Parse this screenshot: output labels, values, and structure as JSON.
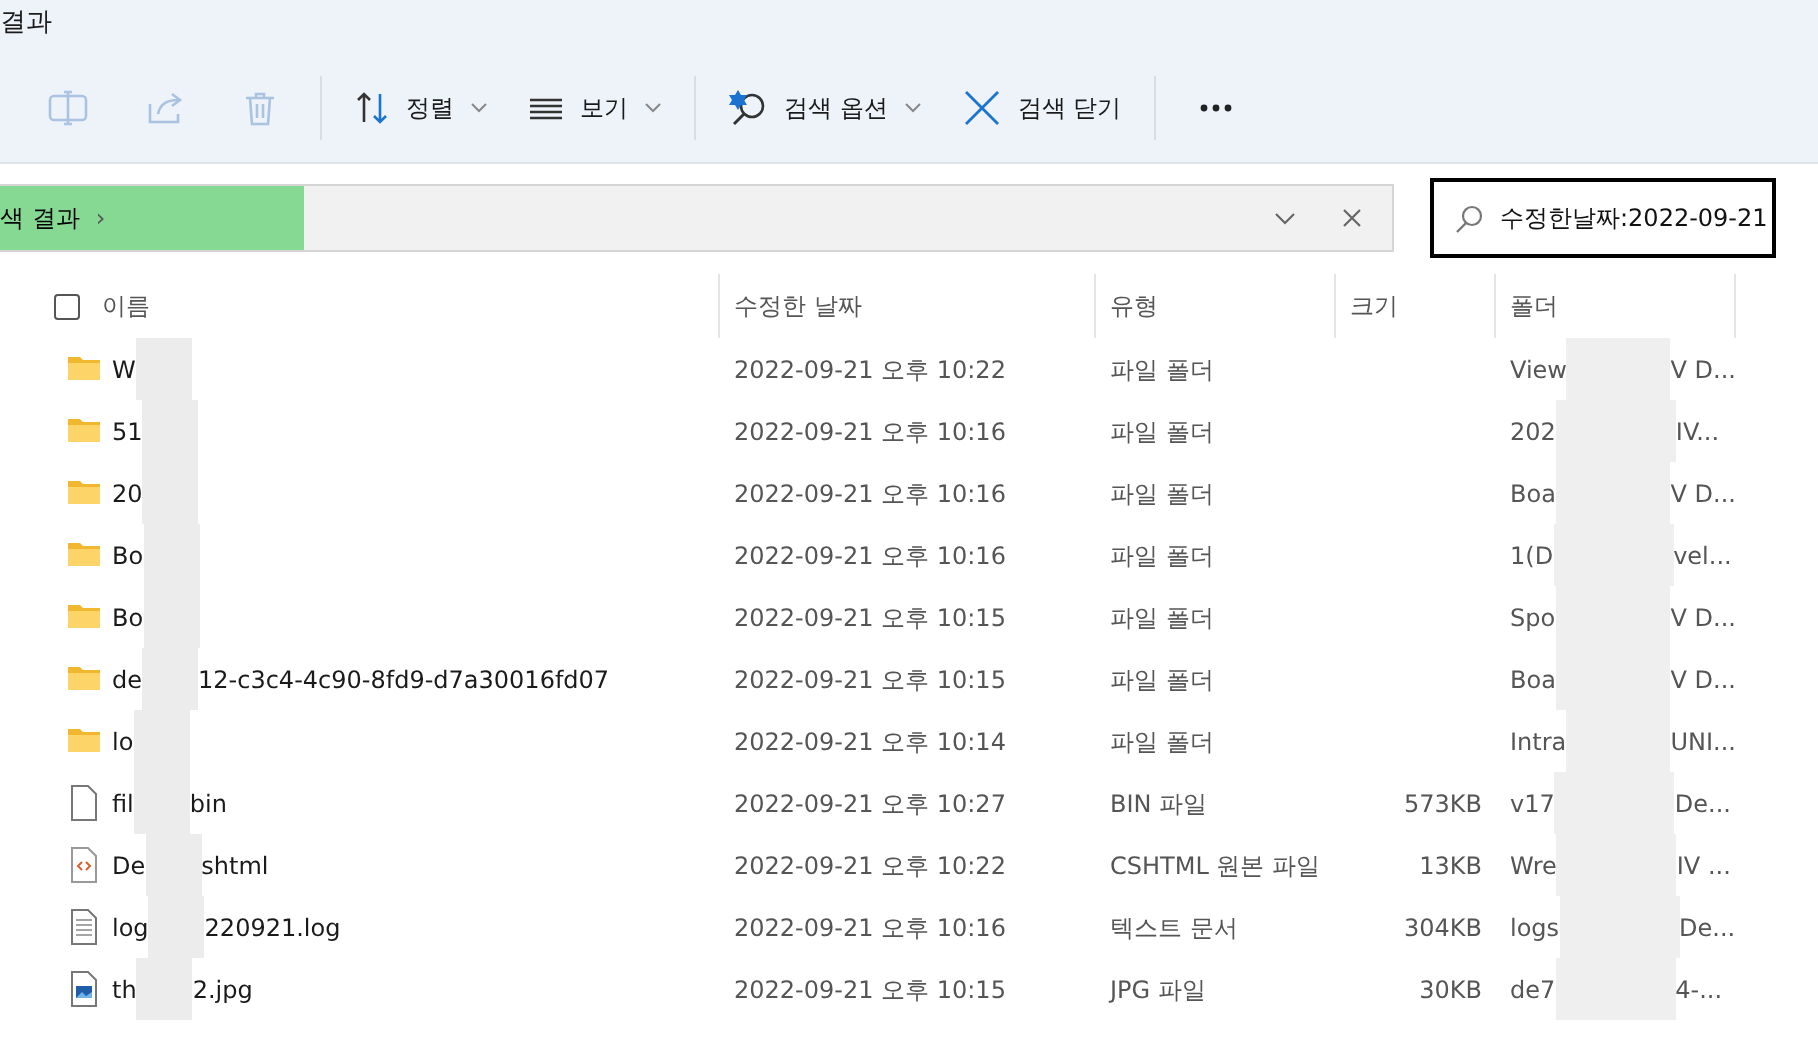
{
  "window": {
    "title": "결과"
  },
  "toolbar": [
    {
      "kind": "rename",
      "disabled": true
    },
    {
      "kind": "share",
      "disabled": true
    },
    {
      "kind": "delete",
      "disabled": true
    },
    {
      "kind": "separator"
    },
    {
      "kind": "sort",
      "label": "정렬",
      "dropdown": true
    },
    {
      "kind": "view",
      "label": "보기",
      "dropdown": true
    },
    {
      "kind": "separator"
    },
    {
      "kind": "search_options",
      "label": "검색 옵션",
      "dropdown": true
    },
    {
      "kind": "close_search",
      "label": "검색 닫기",
      "dropdown": false
    },
    {
      "kind": "separator"
    },
    {
      "kind": "more"
    }
  ],
  "address": {
    "crumb": "색 결과",
    "chevron": "›"
  },
  "search": {
    "value": "수정한날짜:2022-09-21"
  },
  "select_all": {
    "checked": false
  },
  "columns": [
    "이름",
    "수정한 날짜",
    "유형",
    "크기",
    "폴더"
  ],
  "rows": [
    {
      "kind": "folder",
      "name_start": "W",
      "date": "2022-09-21 오후 10:22",
      "type": "파일 폴더",
      "folder_start": "View",
      "folder_end": "V D..."
    },
    {
      "kind": "folder",
      "name_start": "51",
      "date": "2022-09-21 오후 10:16",
      "type": "파일 폴더",
      "folder_start": "202",
      "folder_end": "IV..."
    },
    {
      "kind": "folder",
      "name_start": "20",
      "date": "2022-09-21 오후 10:16",
      "type": "파일 폴더",
      "folder_start": "Boa",
      "folder_end": "V D..."
    },
    {
      "kind": "folder",
      "name_start": "Bo",
      "date": "2022-09-21 오후 10:16",
      "type": "파일 폴더",
      "folder_start": "1(D",
      "folder_end": "vel..."
    },
    {
      "kind": "folder",
      "name_start": "Bo",
      "date": "2022-09-21 오후 10:15",
      "type": "파일 폴더",
      "folder_start": "Spo",
      "folder_end": "V D..."
    },
    {
      "kind": "folder",
      "name_start": "de",
      "name_end": "12-c3c4-4c90-8fd9-d7a30016fd07",
      "date": "2022-09-21 오후 10:15",
      "type": "파일 폴더",
      "folder_start": "Boa",
      "folder_end": "V D..."
    },
    {
      "kind": "folder",
      "name_start": "lo",
      "date": "2022-09-21 오후 10:14",
      "type": "파일 폴더",
      "folder_start": "Intra",
      "folder_end": "UNI..."
    },
    {
      "kind": "file",
      "name_start": "fil",
      "name_end": "bin",
      "date": "2022-09-21 오후 10:27",
      "type": "BIN 파일",
      "size": "573KB",
      "folder_start": "v17",
      "folder_end": "De..."
    },
    {
      "kind": "code",
      "name_start": "De",
      "name_end": "shtml",
      "date": "2022-09-21 오후 10:22",
      "type": "CSHTML 원본 파일",
      "size": "13KB",
      "folder_start": "Wre",
      "folder_end": "IV ..."
    },
    {
      "kind": "text",
      "name_start": "log",
      "name_end": "220921.log",
      "date": "2022-09-21 오후 10:16",
      "type": "텍스트 문서",
      "size": "304KB",
      "folder_start": "logs",
      "folder_end": "De..."
    },
    {
      "kind": "image",
      "name_start": "th",
      "name_end": "2.jpg",
      "date": "2022-09-21 오후 10:15",
      "type": "JPG 파일",
      "size": "30KB",
      "folder_start": "de7",
      "folder_end": "4-..."
    }
  ]
}
